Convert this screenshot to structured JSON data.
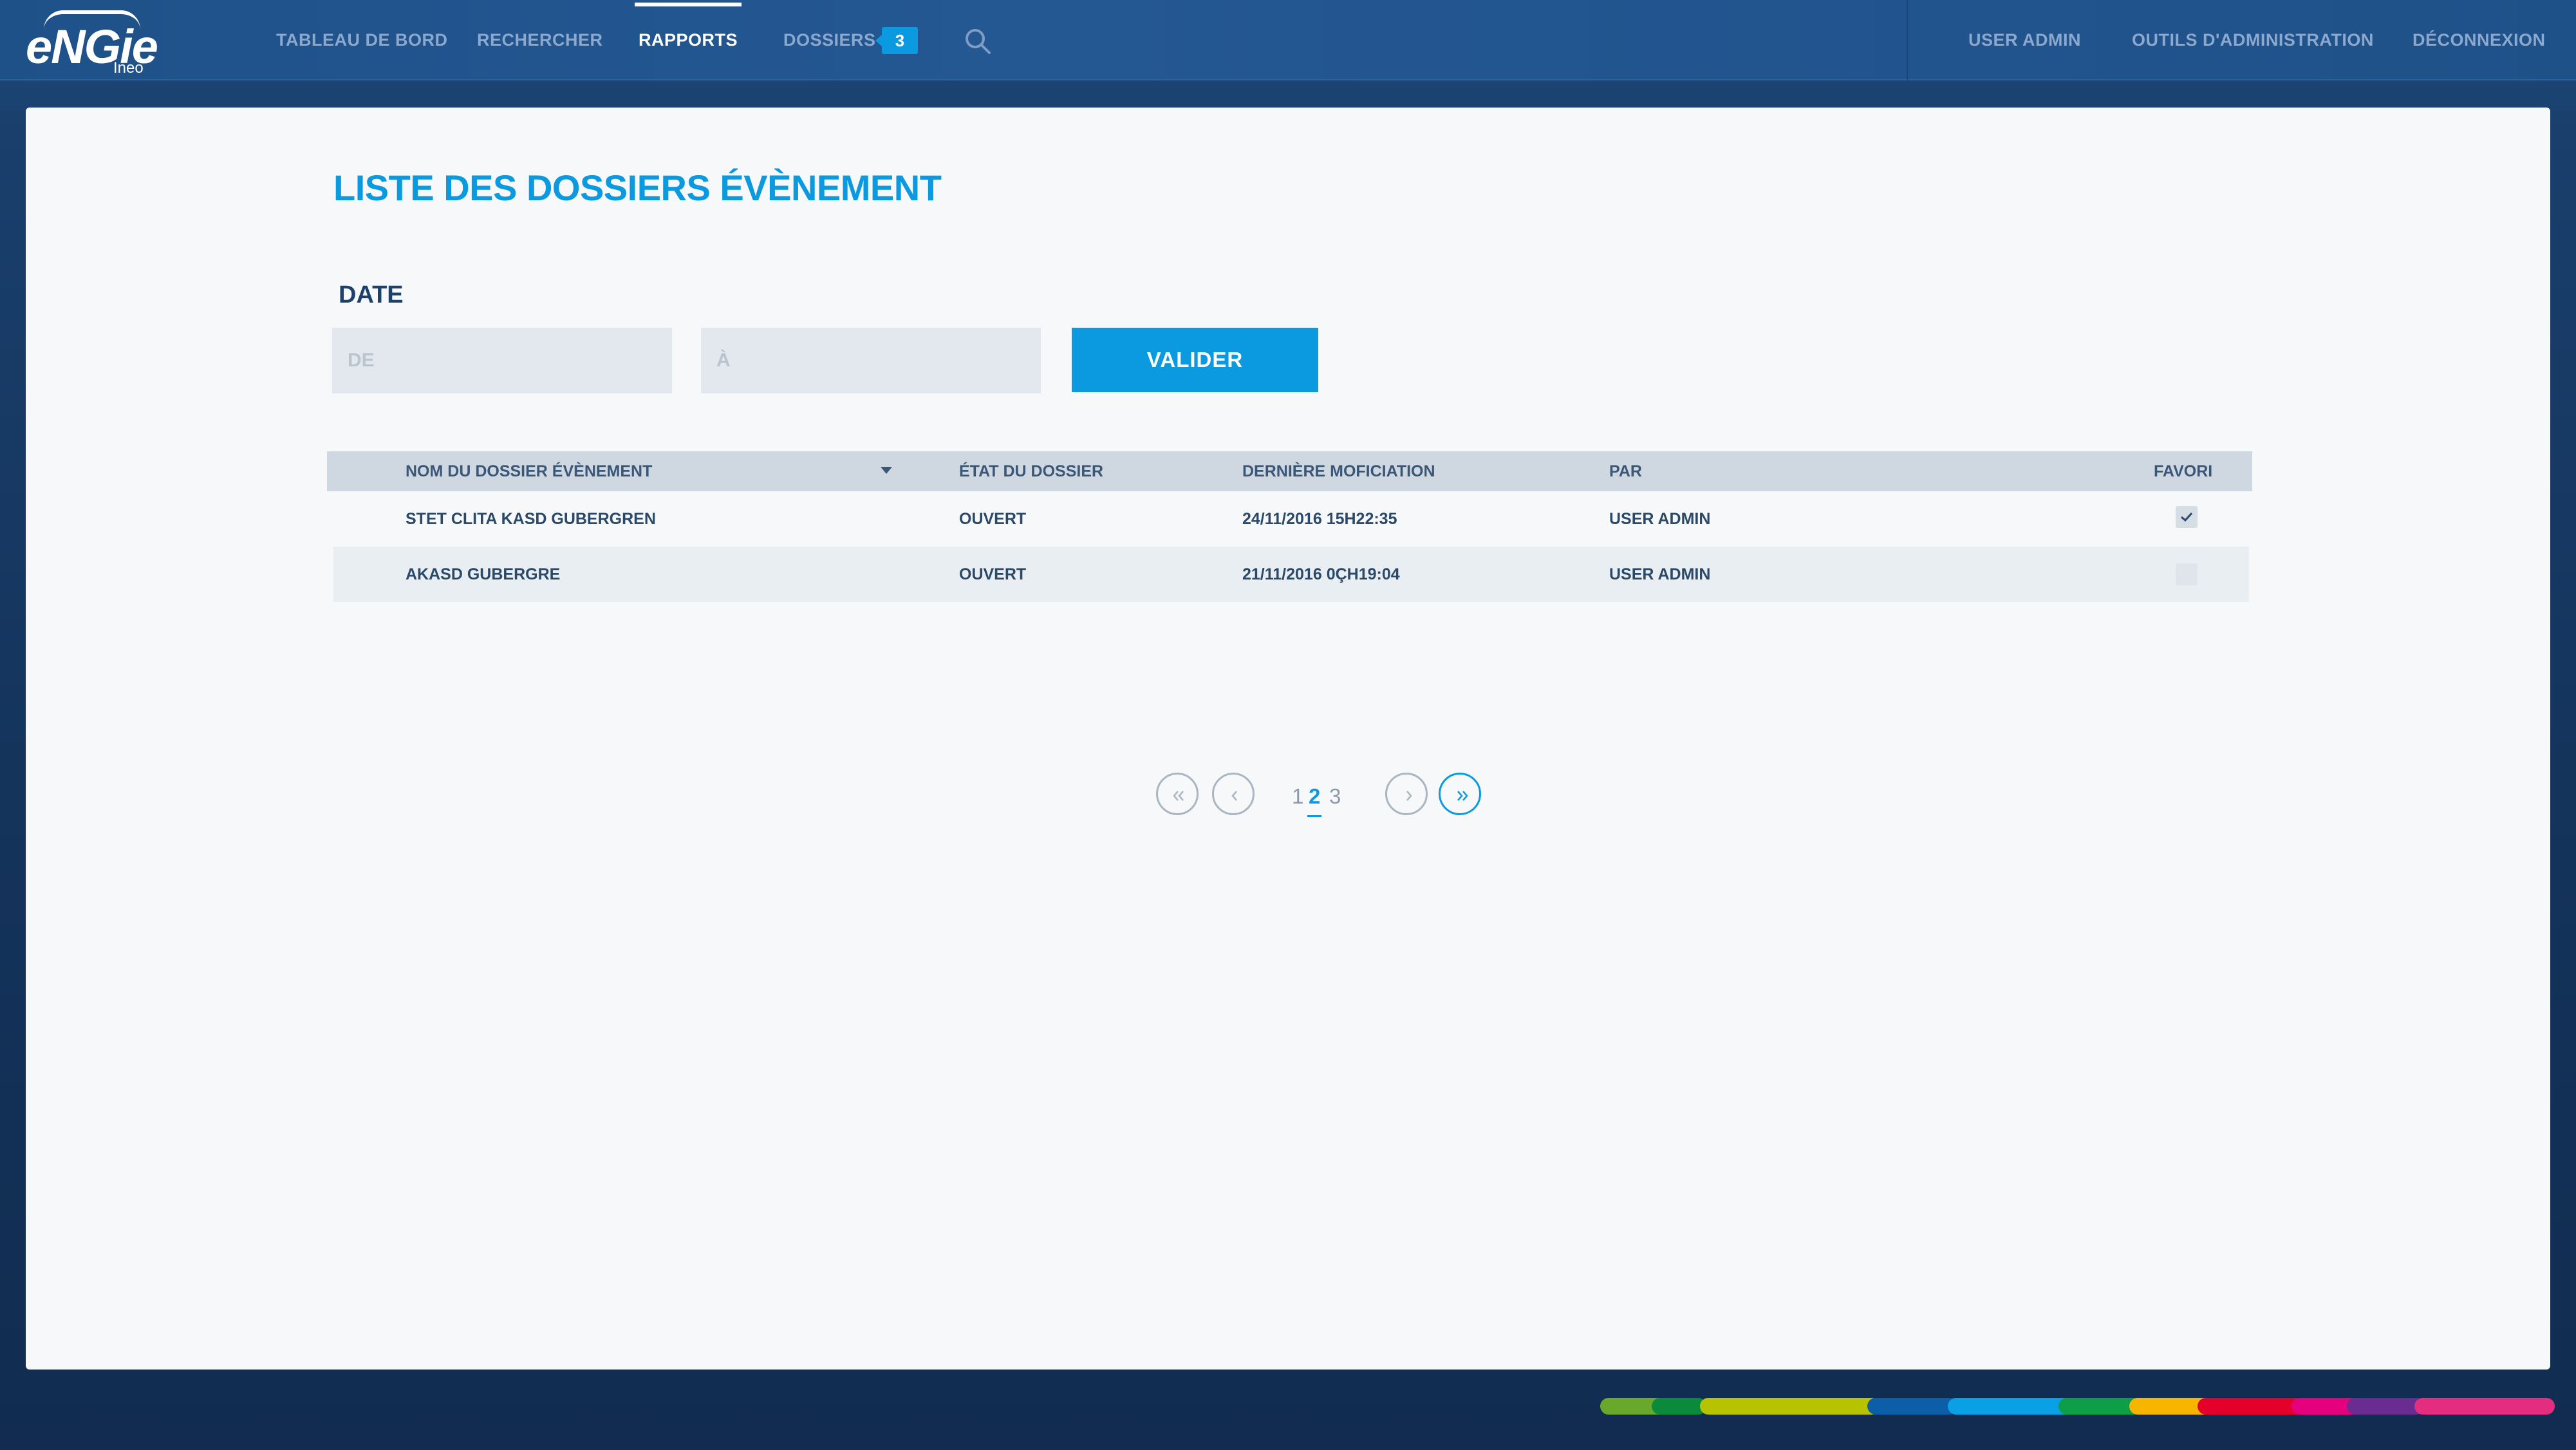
{
  "brand": {
    "name": "eNGie",
    "sub": "Ineo"
  },
  "nav": {
    "left": [
      "TABLEAU DE BORD",
      "RECHERCHER",
      "RAPPORTS",
      "DOSSIERS"
    ],
    "active": "RAPPORTS",
    "dossiers_badge": "3",
    "right": [
      "USER ADMIN",
      "OUTILS D'ADMINISTRATION",
      "DÉCONNEXION"
    ]
  },
  "page": {
    "title": "LISTE DES DOSSIERS ÉVÈNEMENT"
  },
  "filter": {
    "label": "DATE",
    "from_placeholder": "DE",
    "to_placeholder": "À",
    "from_value": "",
    "to_value": "",
    "submit_label": "VALIDER"
  },
  "table": {
    "headers": [
      "NOM DU DOSSIER ÉVÈNEMENT",
      "ÉTAT DU DOSSIER",
      "DERNIÈRE MOFICIATION",
      "PAR",
      "FAVORI"
    ],
    "sorted_column": "NOM DU DOSSIER ÉVÈNEMENT",
    "rows": [
      {
        "name": "STET CLITA KASD GUBERGREN",
        "state": "OUVERT",
        "modified": "24/11/2016 15H22:35",
        "by": "USER ADMIN",
        "favorite": true
      },
      {
        "name": "AKASD GUBERGRE",
        "state": "OUVERT",
        "modified": "21/11/2016 0ÇH19:04",
        "by": "USER ADMIN",
        "favorite": false
      }
    ]
  },
  "pagination": {
    "pages": [
      "1",
      "2",
      "3"
    ],
    "current": "2"
  },
  "colors": {
    "accent": "#0b9ae0",
    "nav_bg": "#245893",
    "heading": "#1d416a",
    "brand_stripe": [
      "#6aa82b",
      "#0a8a3a",
      "#b7c300",
      "#0d5ea8",
      "#0aa0e6",
      "#0e9e47",
      "#f7b500",
      "#e4002b",
      "#e5007e",
      "#6b2c91",
      "#e42d7f"
    ]
  }
}
